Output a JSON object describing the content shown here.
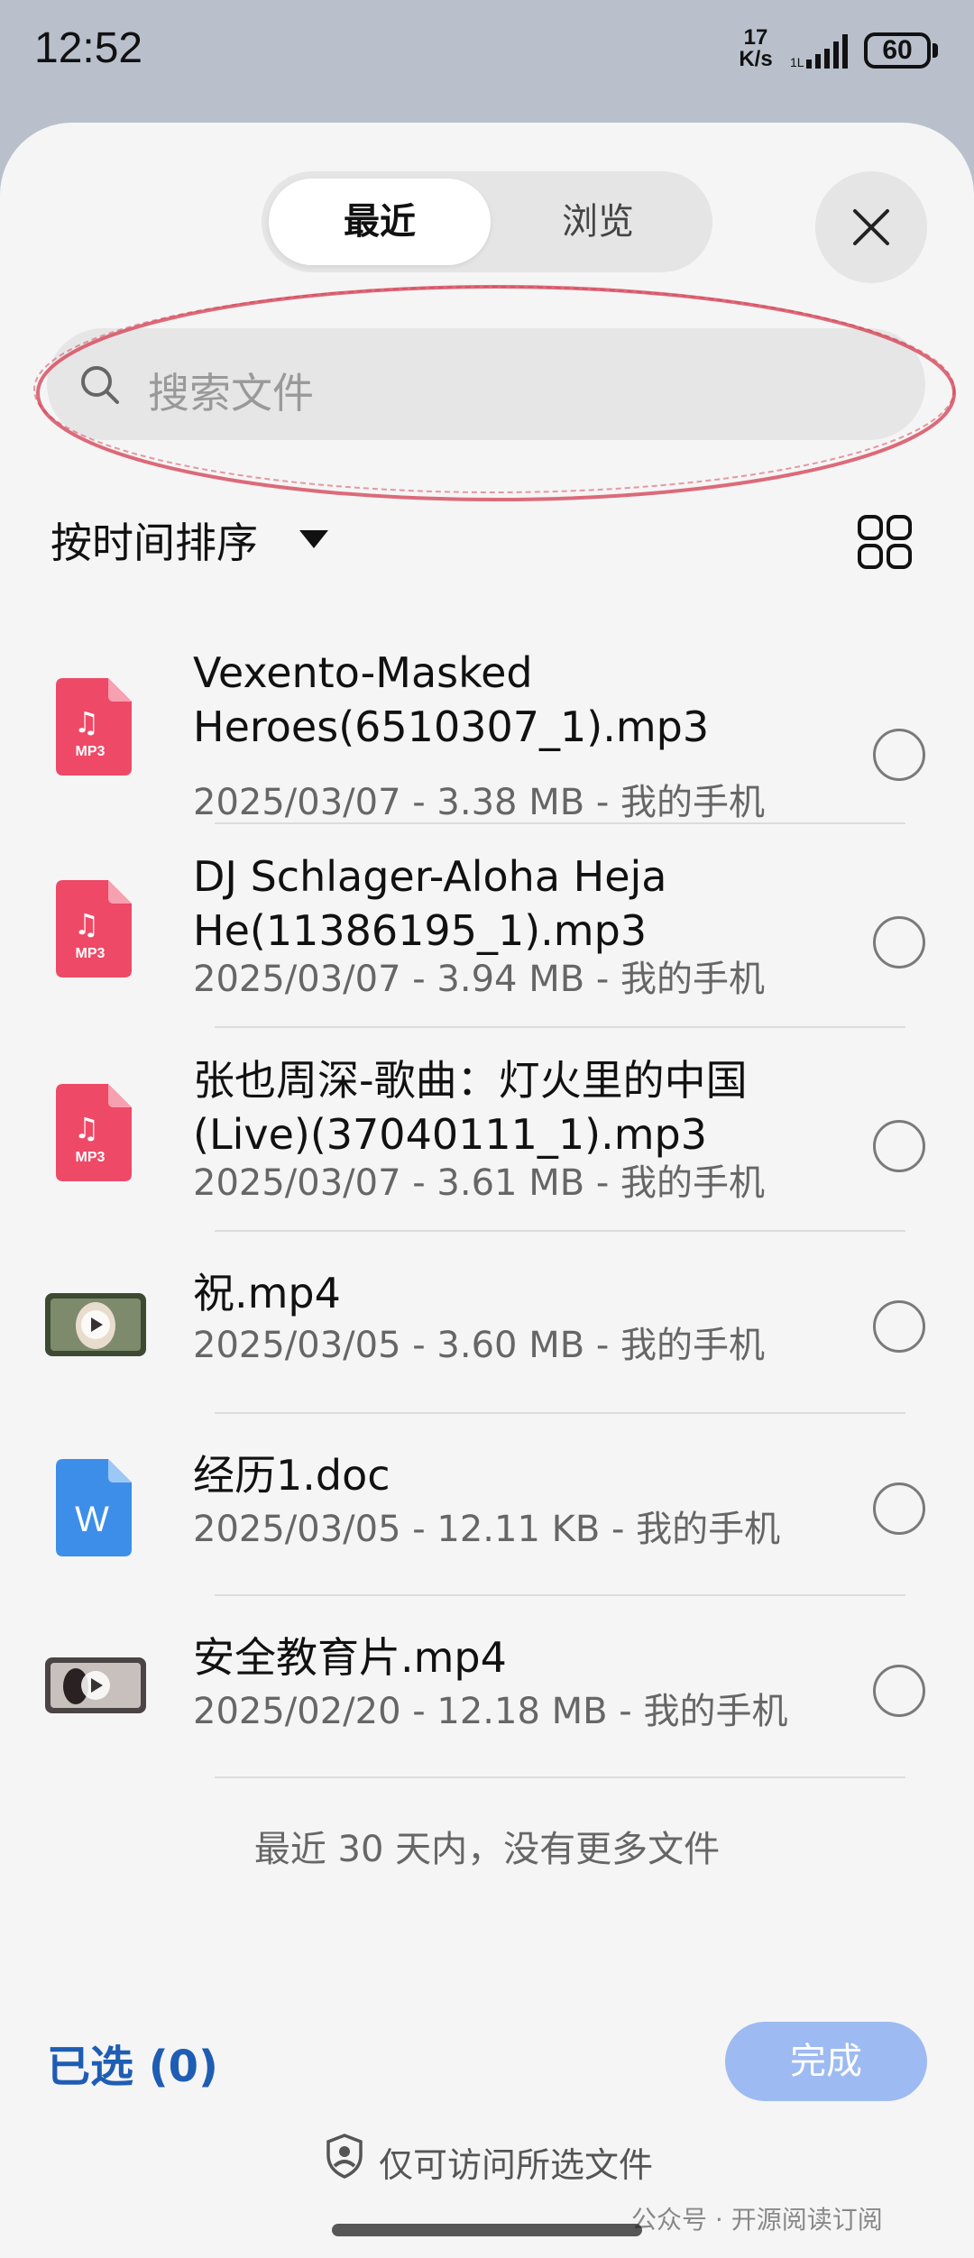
{
  "status_bar": {
    "time": "12:52",
    "net_speed_value": "17",
    "net_speed_unit": "K/s",
    "battery": "60"
  },
  "tabs": {
    "recent": "最近",
    "browse": "浏览"
  },
  "search": {
    "placeholder": "搜索文件"
  },
  "sort": {
    "label": "按时间排序"
  },
  "files": [
    {
      "name": "Vexento-Masked Heroes(6510307_1).mp3",
      "meta": "2025/03/07 - 3.38 MB - 我的手机",
      "icon": "mp3-file-icon",
      "badge": "MP3"
    },
    {
      "name": "DJ Schlager-Aloha Heja He(11386195_1).mp3",
      "meta": "2025/03/07 - 3.94 MB - 我的手机",
      "icon": "mp3-file-icon",
      "badge": "MP3"
    },
    {
      "name": "张也周深-歌曲：灯火里的中国(Live)(37040111_1).mp3",
      "meta": "2025/03/07 - 3.61 MB - 我的手机",
      "icon": "mp3-file-icon",
      "badge": "MP3"
    },
    {
      "name": "祝.mp4",
      "meta": "2025/03/05 - 3.60 MB - 我的手机",
      "icon": "video-thumbnail"
    },
    {
      "name": "经历1.doc",
      "meta": "2025/03/05 - 12.11 KB - 我的手机",
      "icon": "word-doc-icon",
      "badge": "W"
    },
    {
      "name": "安全教育片.mp4",
      "meta": "2025/02/20 - 12.18 MB - 我的手机",
      "icon": "video-thumbnail"
    }
  ],
  "footer_note": "最近 30 天内，没有更多文件",
  "selection": {
    "label": "已选 (0)",
    "done_button": "完成"
  },
  "privacy_note": "仅可访问所选文件",
  "watermark": "公众号 · 开源阅读订阅",
  "colors": {
    "accent_blue": "#1e5db3",
    "done_button_bg": "#9dbaf2",
    "mp3_icon": "#ee4966",
    "doc_icon": "#3d8ee8",
    "annotation_red": "#d33b4f"
  }
}
